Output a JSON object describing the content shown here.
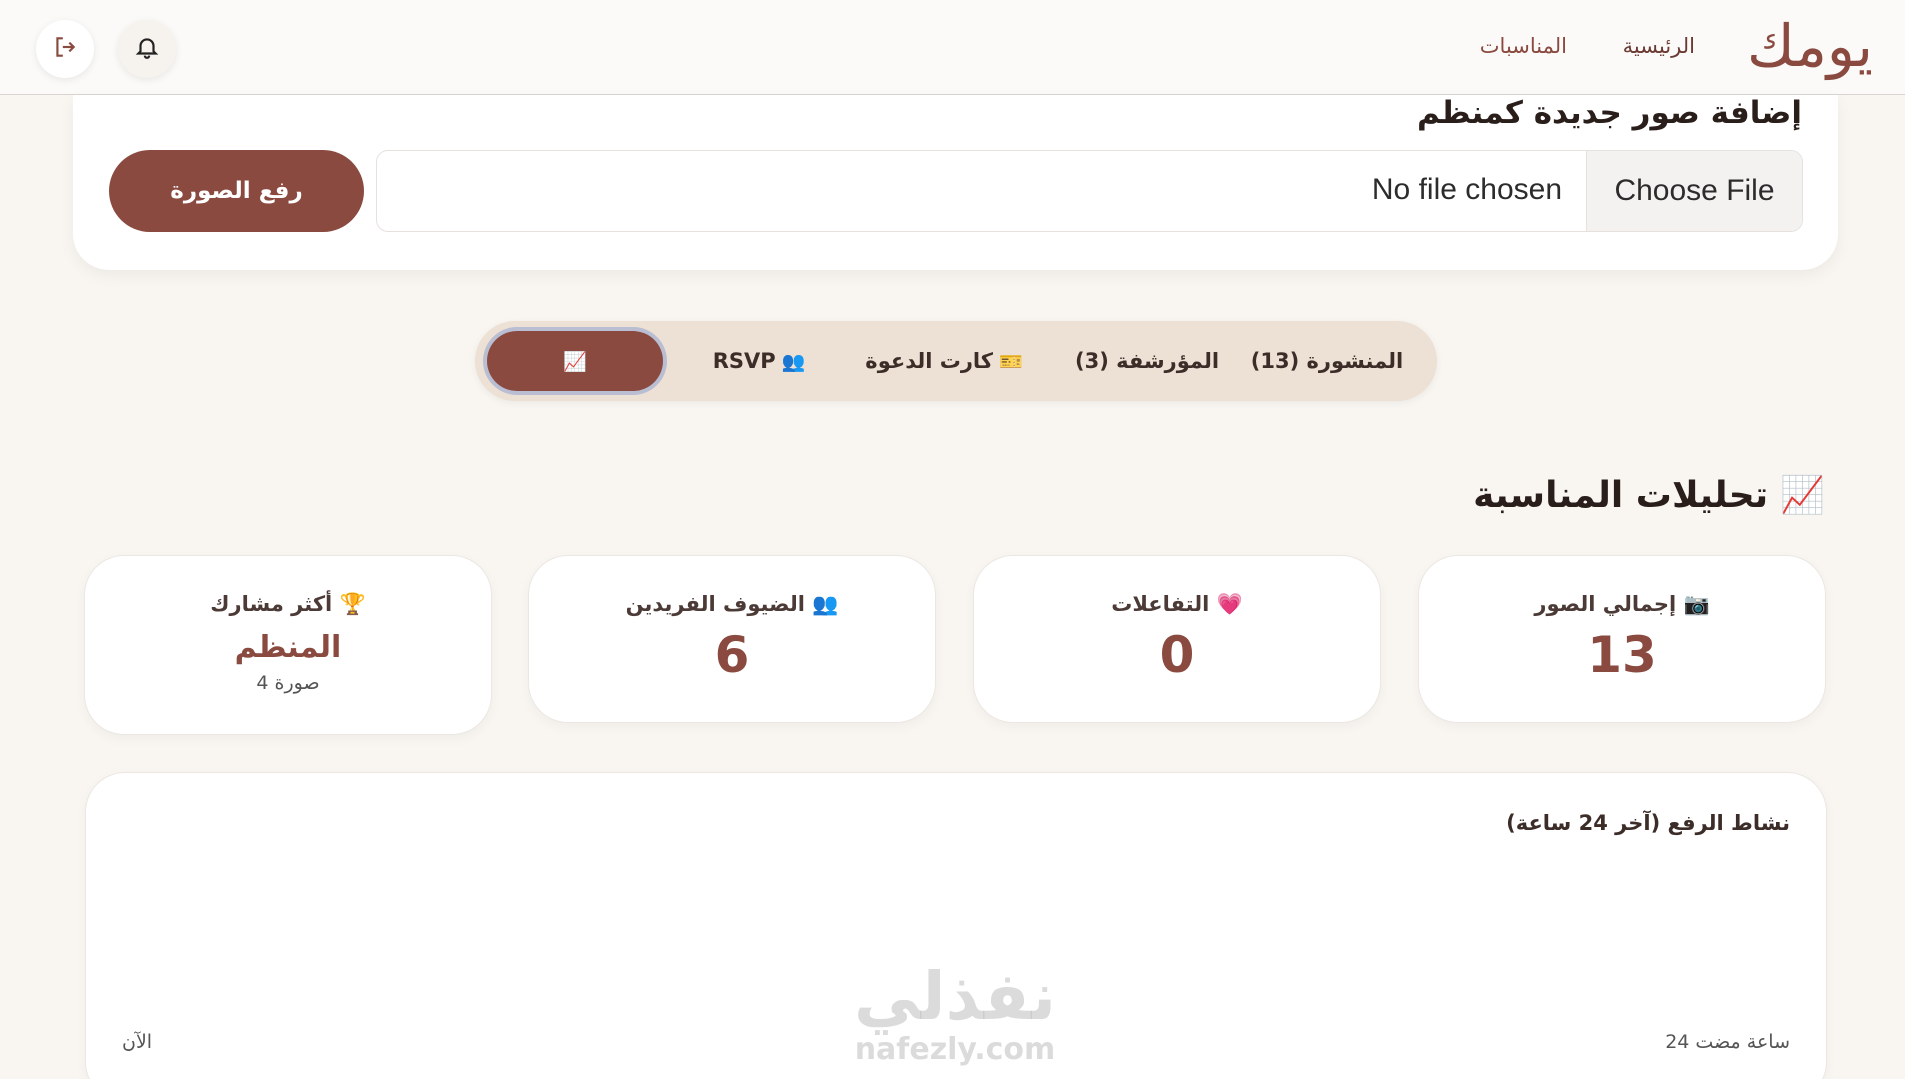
{
  "header": {
    "brand": "يومك",
    "nav": {
      "home": "الرئيسية",
      "events": "المناسبات"
    },
    "icons": {
      "notifications": "bell-icon",
      "logout": "logout-icon"
    }
  },
  "upload": {
    "title": "إضافة صور جديدة كمنظم",
    "choose_file": "Choose File",
    "file_status": "No file chosen",
    "upload_button": "رفع الصورة"
  },
  "tabs": {
    "published": "المنشورة (13)",
    "archived": "المؤرشفة (3)",
    "invite_card": "كارت الدعوة",
    "invite_card_emoji": "🎫",
    "rsvp": "RSVP",
    "rsvp_emoji": "👥",
    "analytics_emoji": "📈"
  },
  "analytics": {
    "title": "تحليلات المناسبة",
    "title_emoji": "📈",
    "cards": {
      "photos": {
        "label": "إجمالي الصور",
        "emoji": "📷",
        "value": "13"
      },
      "reactions": {
        "label": "التفاعلات",
        "emoji": "💗",
        "value": "0"
      },
      "guests": {
        "label": "الضيوف الفريدين",
        "emoji": "👥",
        "value": "6"
      },
      "top_contributor": {
        "label": "أكثر مشارك",
        "emoji": "🏆",
        "value": "المنظم",
        "sub": "4 صورة"
      }
    }
  },
  "activity_chart": {
    "title": "نشاط الرفع (آخر 24 ساعة)",
    "axis_start": "24 ساعة مضت",
    "axis_end": "الآن"
  },
  "watermark": {
    "ar": "نفذلي",
    "en": "nafezly.com"
  },
  "colors": {
    "accent": "#8a4a40",
    "tab_bg": "#ede0d4",
    "page_bg": "#f9f6f2"
  }
}
